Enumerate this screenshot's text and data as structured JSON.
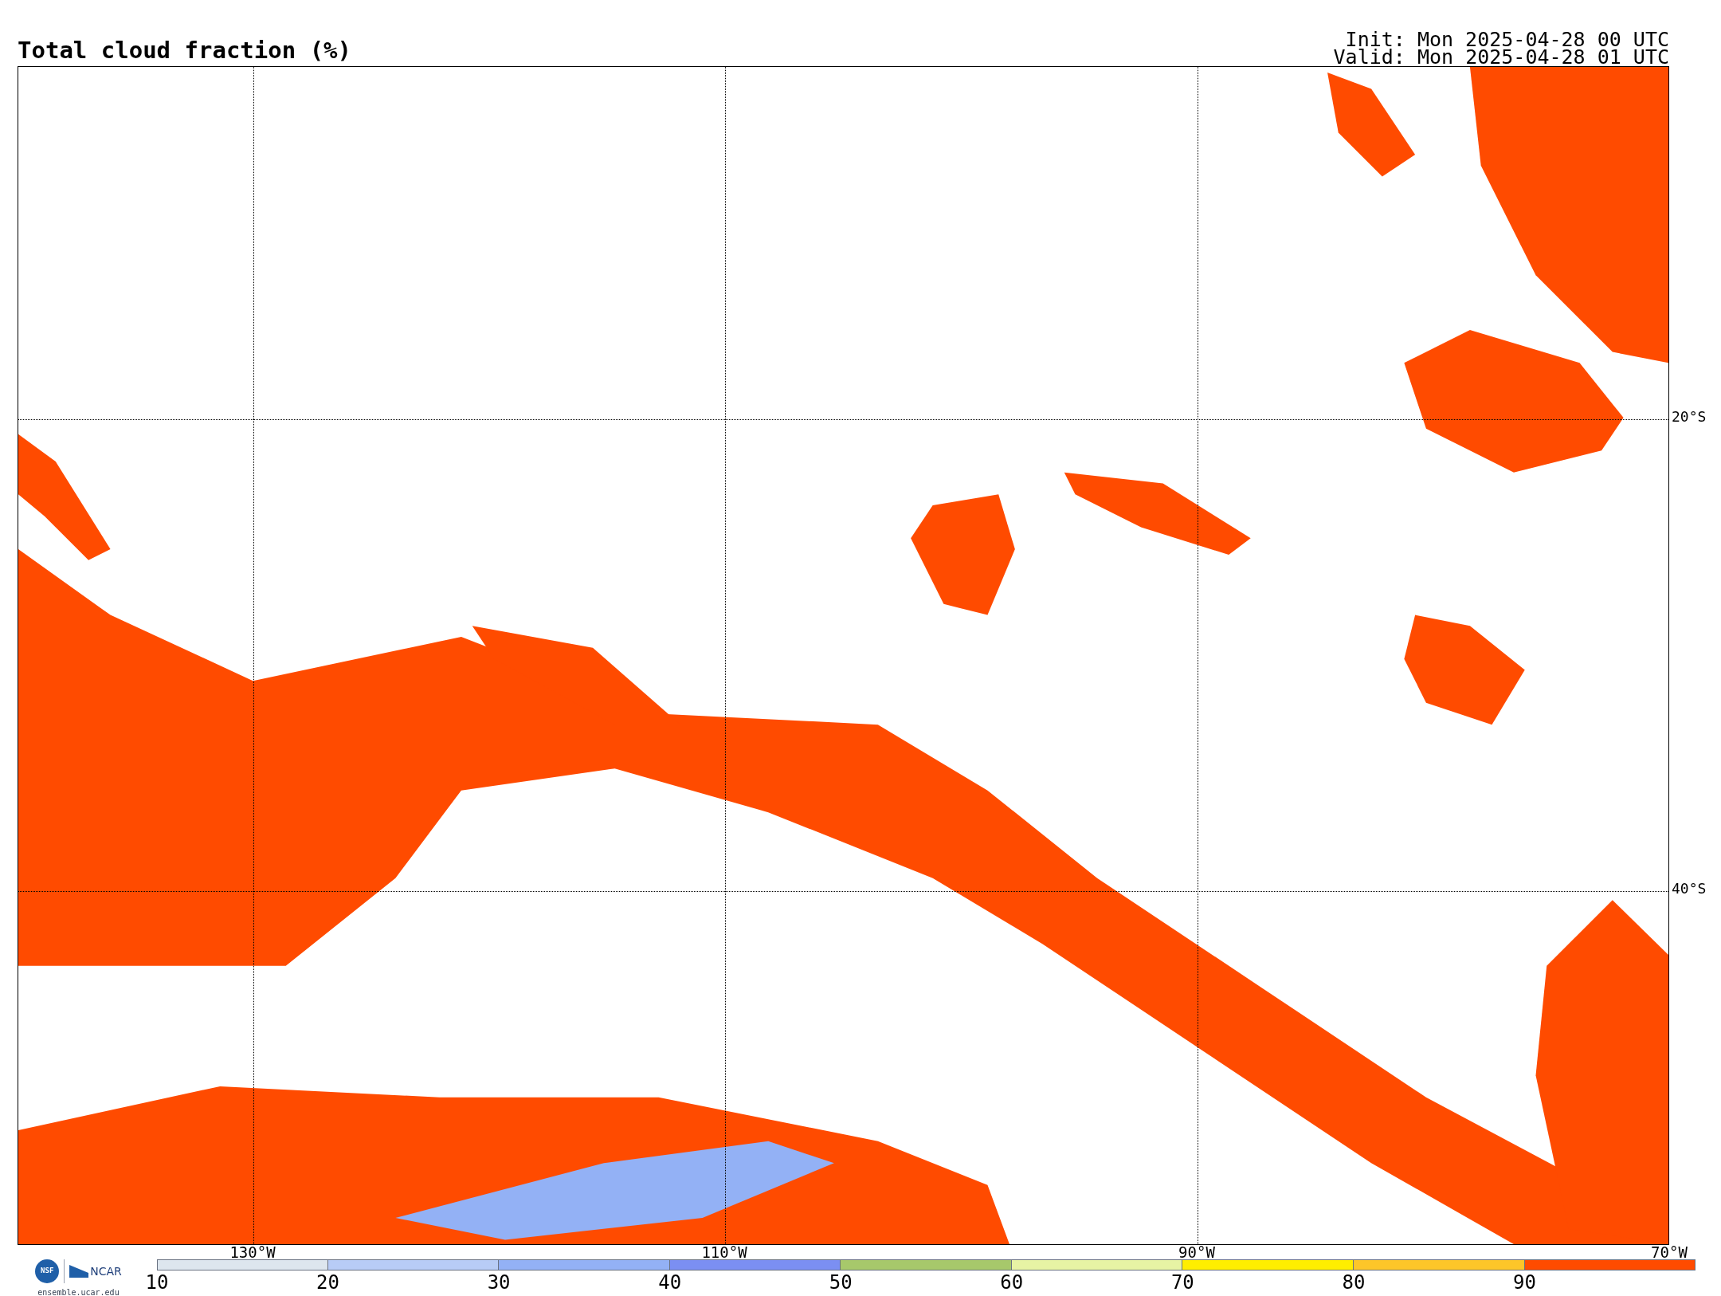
{
  "title": "Total cloud fraction (%)",
  "init": "Init: Mon 2025-04-28 00 UTC",
  "valid": "Valid: Mon 2025-04-28 01 UTC",
  "map": {
    "lat_labels": [
      "20°S",
      "40°S"
    ],
    "lon_labels": [
      "130°W",
      "110°W",
      "90°W",
      "70°W"
    ]
  },
  "logos": {
    "left": "NSF",
    "right": "NCAR"
  },
  "site": "ensemble.ucar.edu",
  "colorbar": {
    "bins": [
      {
        "color": "#dde6ee"
      },
      {
        "color": "#b8ccf6"
      },
      {
        "color": "#93b1f5"
      },
      {
        "color": "#7b8ff2"
      },
      {
        "color": "#a7c86b"
      },
      {
        "color": "#e7f3a4"
      },
      {
        "color": "#ffee00"
      },
      {
        "color": "#fdc629"
      },
      {
        "color": "#ff4b00"
      }
    ],
    "ticks": [
      "10",
      "20",
      "30",
      "40",
      "50",
      "60",
      "70",
      "80",
      "90"
    ]
  }
}
